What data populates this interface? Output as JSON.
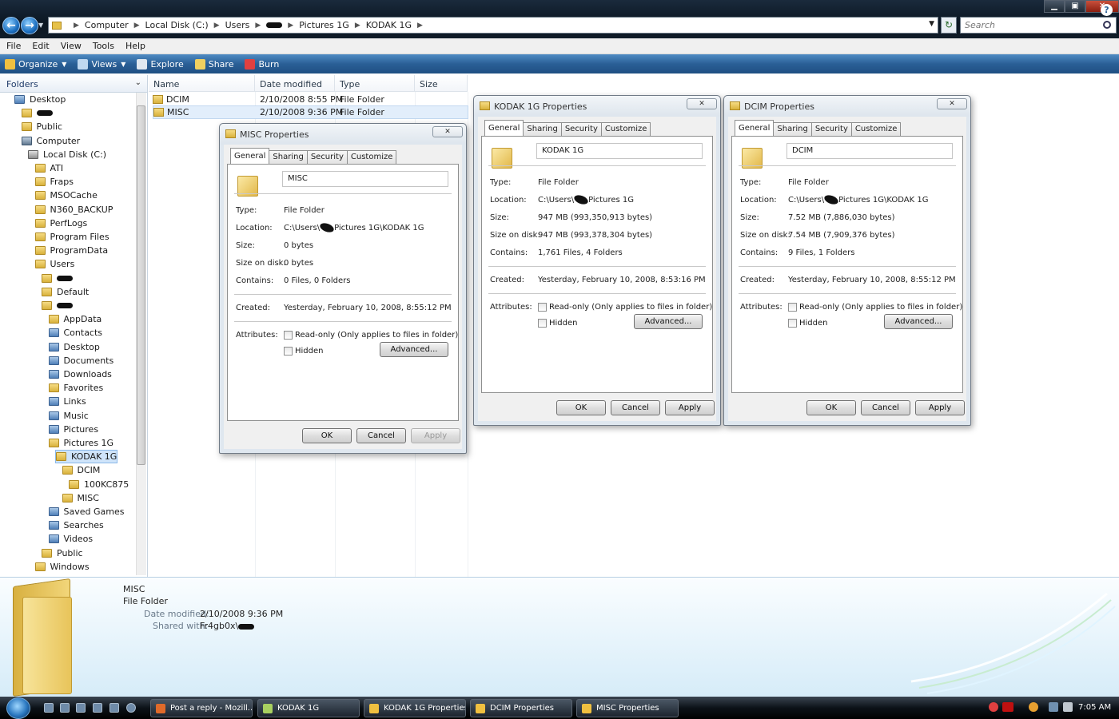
{
  "window": {
    "controls": {
      "minimize": "▁",
      "maximize": "▣",
      "close": "✕"
    },
    "nav": {
      "back": "←",
      "forward": "→",
      "dropdown": "▼"
    },
    "address": {
      "crumbs": [
        "Computer",
        "Local Disk (C:)",
        "Users",
        "",
        "Pictures 1G",
        "KODAK 1G"
      ],
      "separator": "▶"
    },
    "search_placeholder": "Search"
  },
  "menu": [
    "File",
    "Edit",
    "View",
    "Tools",
    "Help"
  ],
  "commands": [
    {
      "label": "Organize",
      "dropdown": true,
      "icon": "organize-icon",
      "color": "#f0c040"
    },
    {
      "label": "Views",
      "dropdown": true,
      "icon": "views-icon",
      "color": "#c0d8f0"
    },
    {
      "label": "Explore",
      "dropdown": false,
      "icon": "explore-icon",
      "color": "#e0e8f0"
    },
    {
      "label": "Share",
      "dropdown": false,
      "icon": "share-icon",
      "color": "#f0d060"
    },
    {
      "label": "Burn",
      "dropdown": false,
      "icon": "burn-icon",
      "color": "#e04040"
    }
  ],
  "tree": {
    "header": "Folders",
    "items": [
      {
        "label": "Desktop",
        "indent": 0,
        "icon": "blue"
      },
      {
        "label": "",
        "indent": 1,
        "icon": "folder",
        "redacted": true
      },
      {
        "label": "Public",
        "indent": 1,
        "icon": "folder"
      },
      {
        "label": "Computer",
        "indent": 1,
        "icon": "comp"
      },
      {
        "label": "Local Disk (C:)",
        "indent": 2,
        "icon": "drive"
      },
      {
        "label": "ATI",
        "indent": 3,
        "icon": "folder"
      },
      {
        "label": "Fraps",
        "indent": 3,
        "icon": "folder"
      },
      {
        "label": "MSOCache",
        "indent": 3,
        "icon": "folder"
      },
      {
        "label": "N360_BACKUP",
        "indent": 3,
        "icon": "folder"
      },
      {
        "label": "PerfLogs",
        "indent": 3,
        "icon": "folder"
      },
      {
        "label": "Program Files",
        "indent": 3,
        "icon": "folder"
      },
      {
        "label": "ProgramData",
        "indent": 3,
        "icon": "folder"
      },
      {
        "label": "Users",
        "indent": 3,
        "icon": "folder"
      },
      {
        "label": "",
        "indent": 4,
        "icon": "folder",
        "redacted": true
      },
      {
        "label": "Default",
        "indent": 4,
        "icon": "folder"
      },
      {
        "label": "",
        "indent": 4,
        "icon": "folder",
        "redacted": true
      },
      {
        "label": "AppData",
        "indent": 5,
        "icon": "folder"
      },
      {
        "label": "Contacts",
        "indent": 5,
        "icon": "blue"
      },
      {
        "label": "Desktop",
        "indent": 5,
        "icon": "blue"
      },
      {
        "label": "Documents",
        "indent": 5,
        "icon": "blue"
      },
      {
        "label": "Downloads",
        "indent": 5,
        "icon": "blue"
      },
      {
        "label": "Favorites",
        "indent": 5,
        "icon": "folder"
      },
      {
        "label": "Links",
        "indent": 5,
        "icon": "blue"
      },
      {
        "label": "Music",
        "indent": 5,
        "icon": "blue"
      },
      {
        "label": "Pictures",
        "indent": 5,
        "icon": "blue"
      },
      {
        "label": "Pictures 1G",
        "indent": 5,
        "icon": "folder"
      },
      {
        "label": "KODAK 1G",
        "indent": 6,
        "icon": "folder",
        "selected": true
      },
      {
        "label": "DCIM",
        "indent": 7,
        "icon": "folder"
      },
      {
        "label": "100KC875",
        "indent": 8,
        "icon": "folder"
      },
      {
        "label": "MISC",
        "indent": 7,
        "icon": "folder"
      },
      {
        "label": "Saved Games",
        "indent": 5,
        "icon": "blue"
      },
      {
        "label": "Searches",
        "indent": 5,
        "icon": "blue"
      },
      {
        "label": "Videos",
        "indent": 5,
        "icon": "blue"
      },
      {
        "label": "Public",
        "indent": 4,
        "icon": "folder"
      },
      {
        "label": "Windows",
        "indent": 3,
        "icon": "folder"
      }
    ]
  },
  "list": {
    "columns": [
      "Name",
      "Date modified",
      "Type",
      "Size"
    ],
    "rows": [
      {
        "name": "DCIM",
        "date": "2/10/2008 8:55 PM",
        "type": "File Folder",
        "size": ""
      },
      {
        "name": "MISC",
        "date": "2/10/2008 9:36 PM",
        "type": "File Folder",
        "size": "",
        "selected": true
      }
    ]
  },
  "dialogs": [
    {
      "id": "misc",
      "title": "MISC Properties",
      "tabs": [
        "General",
        "Sharing",
        "Security",
        "Customize"
      ],
      "name": "MISC",
      "labels": {
        "type": "Type:",
        "location": "Location:",
        "size": "Size:",
        "size_on_disk": "Size on disk:",
        "contains": "Contains:",
        "created": "Created:",
        "attributes": "Attributes:"
      },
      "type": "File Folder",
      "location_prefix": "C:\\Users\\",
      "location_suffix": "Pictures 1G\\KODAK 1G",
      "size": "0 bytes",
      "size_on_disk": "0 bytes",
      "contains": "0 Files, 0 Folders",
      "created": "Yesterday, February 10, 2008, 8:55:12 PM",
      "readonly": "Read-only (Only applies to files in folder)",
      "hidden": "Hidden",
      "advanced": "Advanced...",
      "ok": "OK",
      "cancel": "Cancel",
      "apply": "Apply"
    },
    {
      "id": "kodak",
      "title": "KODAK 1G Properties",
      "tabs": [
        "General",
        "Sharing",
        "Security",
        "Customize"
      ],
      "name": "KODAK 1G",
      "labels": {
        "type": "Type:",
        "location": "Location:",
        "size": "Size:",
        "size_on_disk": "Size on disk:",
        "contains": "Contains:",
        "created": "Created:",
        "attributes": "Attributes:"
      },
      "type": "File Folder",
      "location_prefix": "C:\\Users\\",
      "location_suffix": "Pictures 1G",
      "size": "947 MB (993,350,913 bytes)",
      "size_on_disk": "947 MB (993,378,304 bytes)",
      "contains": "1,761 Files, 4 Folders",
      "created": "Yesterday, February 10, 2008, 8:53:16 PM",
      "readonly": "Read-only (Only applies to files in folder)",
      "hidden": "Hidden",
      "advanced": "Advanced...",
      "ok": "OK",
      "cancel": "Cancel",
      "apply": "Apply"
    },
    {
      "id": "dcim",
      "title": "DCIM Properties",
      "tabs": [
        "General",
        "Sharing",
        "Security",
        "Customize"
      ],
      "name": "DCIM",
      "labels": {
        "type": "Type:",
        "location": "Location:",
        "size": "Size:",
        "size_on_disk": "Size on disk:",
        "contains": "Contains:",
        "created": "Created:",
        "attributes": "Attributes:"
      },
      "type": "File Folder",
      "location_prefix": "C:\\Users\\",
      "location_suffix": "Pictures 1G\\KODAK 1G",
      "size": "7.52 MB (7,886,030 bytes)",
      "size_on_disk": "7.54 MB (7,909,376 bytes)",
      "contains": "9 Files, 1 Folders",
      "created": "Yesterday, February 10, 2008, 8:55:12 PM",
      "readonly": "Read-only (Only applies to files in folder)",
      "hidden": "Hidden",
      "advanced": "Advanced...",
      "ok": "OK",
      "cancel": "Cancel",
      "apply": "Apply"
    }
  ],
  "details": {
    "name": "MISC",
    "type": "File Folder",
    "date_label": "Date modified:",
    "date": "2/10/2008 9:36 PM",
    "shared_label": "Shared with:",
    "shared": "Fr4gb0x\\"
  },
  "taskbar": {
    "items": [
      {
        "label": "Post a reply - Mozill...",
        "color": "#e06a2a"
      },
      {
        "label": "KODAK 1G",
        "color": "#a8d060"
      },
      {
        "label": "KODAK 1G Properties",
        "color": "#f0c040"
      },
      {
        "label": "DCIM Properties",
        "color": "#f0c040"
      },
      {
        "label": "MISC Properties",
        "color": "#f0c040"
      }
    ],
    "clock": "7:05 AM"
  }
}
